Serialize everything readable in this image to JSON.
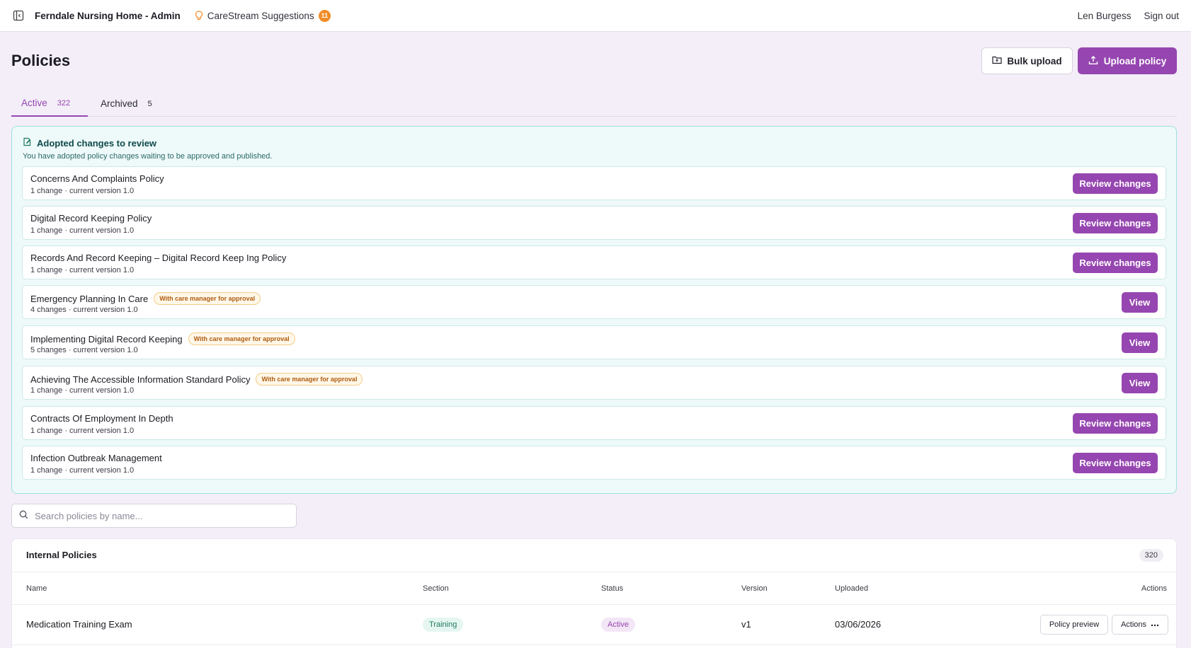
{
  "topbar": {
    "app_title": "Ferndale Nursing Home - Admin",
    "suggestions_label": "CareStream Suggestions",
    "suggestions_count": "11",
    "user_name": "Len Burgess",
    "sign_out": "Sign out"
  },
  "header": {
    "title": "Policies",
    "bulk_upload": "Bulk upload",
    "upload_policy": "Upload policy"
  },
  "tabs": [
    {
      "label": "Active",
      "count": "322"
    },
    {
      "label": "Archived",
      "count": "5"
    }
  ],
  "review": {
    "title": "Adopted changes to review",
    "subtitle": "You have adopted policy changes waiting to be approved and published.",
    "items": [
      {
        "name": "Concerns And Complaints Policy",
        "meta": "1 change · current version 1.0",
        "badge": "",
        "action": "Review changes"
      },
      {
        "name": "Digital Record Keeping Policy",
        "meta": "1 change · current version 1.0",
        "badge": "",
        "action": "Review changes"
      },
      {
        "name": "Records And Record Keeping – Digital Record Keep Ing Policy",
        "meta": "1 change · current version 1.0",
        "badge": "",
        "action": "Review changes"
      },
      {
        "name": "Emergency Planning In Care",
        "meta": "4 changes · current version 1.0",
        "badge": "With care manager for approval",
        "action": "View"
      },
      {
        "name": "Implementing Digital Record Keeping",
        "meta": "5 changes · current version 1.0",
        "badge": "With care manager for approval",
        "action": "View"
      },
      {
        "name": "Achieving The Accessible Information Standard Policy",
        "meta": "1 change · current version 1.0",
        "badge": "With care manager for approval",
        "action": "View"
      },
      {
        "name": "Contracts Of Employment In Depth",
        "meta": "1 change · current version 1.0",
        "badge": "",
        "action": "Review changes"
      },
      {
        "name": "Infection Outbreak Management",
        "meta": "1 change · current version 1.0",
        "badge": "",
        "action": "Review changes"
      }
    ]
  },
  "search": {
    "placeholder": "Search policies by name...",
    "value": ""
  },
  "internal": {
    "title": "Internal Policies",
    "count": "320",
    "columns": {
      "name": "Name",
      "section": "Section",
      "status": "Status",
      "version": "Version",
      "uploaded": "Uploaded",
      "actions": "Actions"
    },
    "rows": [
      {
        "name": "Medication Training Exam",
        "section": "Training",
        "status": "Active",
        "version": "v1",
        "uploaded": "03/06/2026",
        "preview": "Policy preview",
        "actions": "Actions"
      }
    ]
  },
  "colors": {
    "accent": "#9646b0",
    "panel_border": "#9ee1de",
    "badge_orange": "#f28c28"
  }
}
